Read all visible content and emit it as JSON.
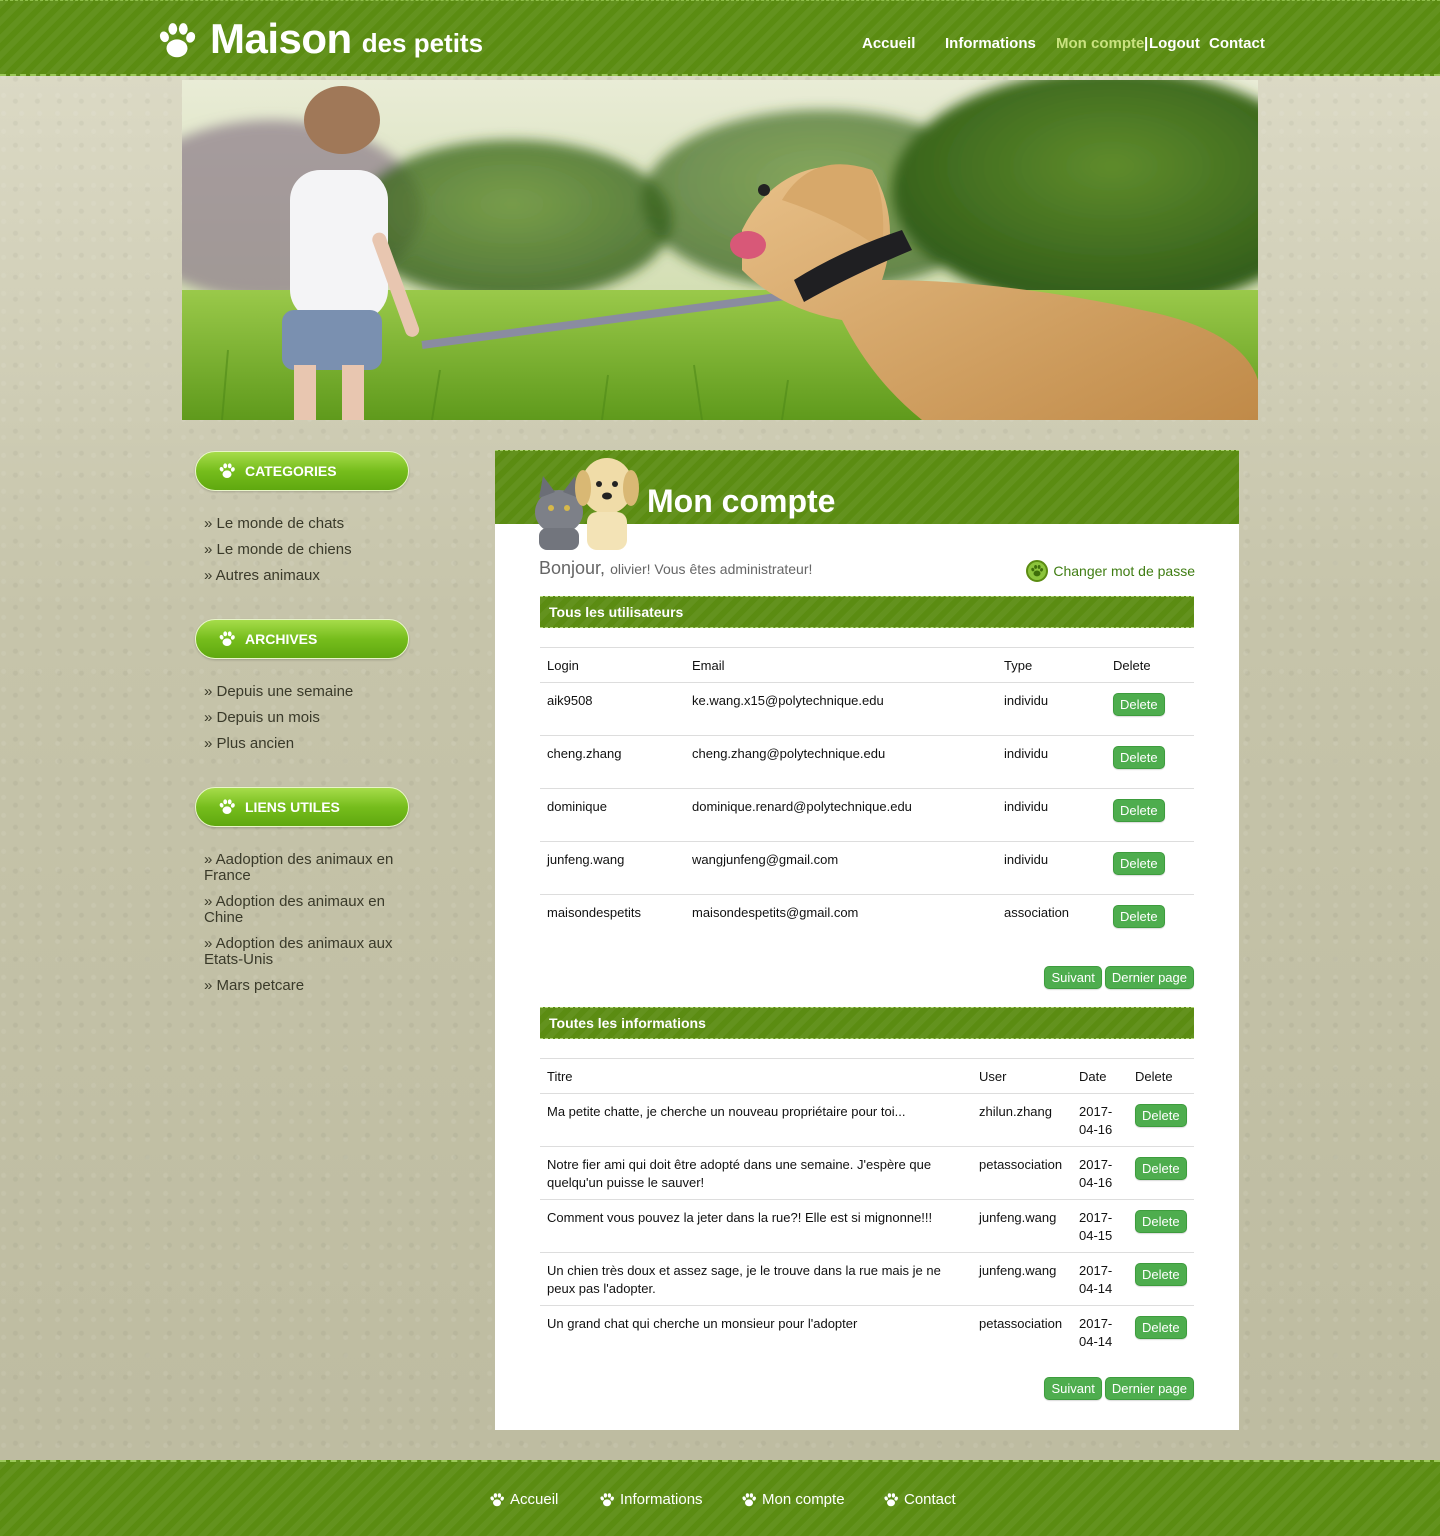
{
  "brand": {
    "name_big": "Maison",
    "name_small": "des petits"
  },
  "topnav": {
    "accueil": "Accueil",
    "informations": "Informations",
    "mon_compte": "Mon compte",
    "sep": "|",
    "logout": "Logout",
    "contact": "Contact"
  },
  "sidebar": {
    "categories": {
      "title": "CATEGORIES",
      "items": [
        "» Le monde de chats",
        "» Le monde de chiens",
        "» Autres animaux"
      ]
    },
    "archives": {
      "title": "ARCHIVES",
      "items": [
        "» Depuis une semaine",
        "» Depuis un mois",
        "» Plus ancien"
      ]
    },
    "liens": {
      "title": "LIENS UTILES",
      "items": [
        "» Aadoption des animaux en France",
        "» Adoption des animaux en Chine",
        "» Adoption des animaux aux Etats-Unis",
        "» Mars petcare"
      ]
    }
  },
  "main": {
    "title": "Mon compte",
    "greeting": "Bonjour,",
    "greeting_rest": "olivier! Vous êtes administrateur!",
    "change_password": "Changer mot de passe"
  },
  "users": {
    "title": "Tous les utilisateurs",
    "headers": [
      "Login",
      "Email",
      "Type",
      "Delete"
    ],
    "rows": [
      {
        "login": "aik9508",
        "email": "ke.wang.x15@polytechnique.edu",
        "type": "individu"
      },
      {
        "login": "cheng.zhang",
        "email": "cheng.zhang@polytechnique.edu",
        "type": "individu"
      },
      {
        "login": "dominique",
        "email": "dominique.renard@polytechnique.edu",
        "type": "individu"
      },
      {
        "login": "junfeng.wang",
        "email": "wangjunfeng@gmail.com",
        "type": "individu"
      },
      {
        "login": "maisondespetits",
        "email": "maisondespetits@gmail.com",
        "type": "association"
      }
    ],
    "delete_label": "Delete",
    "next_label": "Suivant",
    "last_label": "Dernier page"
  },
  "infos": {
    "title": "Toutes les informations",
    "headers": [
      "Titre",
      "User",
      "Date",
      "Delete"
    ],
    "rows": [
      {
        "titre": "Ma petite chatte, je cherche un nouveau propriétaire pour toi...",
        "user": "zhilun.zhang",
        "date": "2017-04-16"
      },
      {
        "titre": "Notre fier ami qui doit être adopté dans une semaine. J'espère que quelqu'un puisse le sauver!",
        "user": "petassociation",
        "date": "2017-04-16"
      },
      {
        "titre": "Comment vous pouvez la jeter dans la rue?! Elle est si mignonne!!!",
        "user": "junfeng.wang",
        "date": "2017-04-15"
      },
      {
        "titre": "Un chien très doux et assez sage, je le trouve dans la rue mais je ne peux pas l'adopter.",
        "user": "junfeng.wang",
        "date": "2017-04-14"
      },
      {
        "titre": "Un grand chat qui cherche un monsieur pour l'adopter",
        "user": "petassociation",
        "date": "2017-04-14"
      }
    ],
    "delete_label": "Delete",
    "next_label": "Suivant",
    "last_label": "Dernier page"
  },
  "footer": {
    "accueil": "Accueil",
    "informations": "Informations",
    "mon_compte": "Mon compte",
    "contact": "Contact"
  },
  "colors": {
    "brand_green": "#5b8c12",
    "button_green": "#4ead4e",
    "active_nav": "#c9e27f"
  }
}
